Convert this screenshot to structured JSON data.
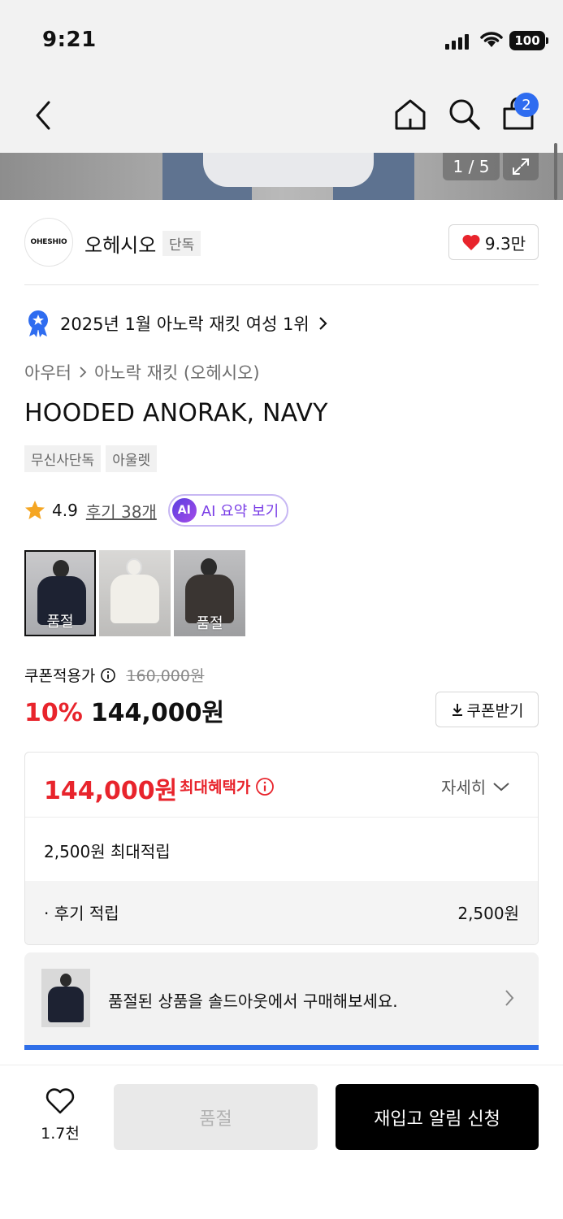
{
  "status_bar": {
    "time": "9:21",
    "battery": "100"
  },
  "nav": {
    "cart_count": "2"
  },
  "gallery": {
    "counter": "1 / 5"
  },
  "brand": {
    "logo_text": "OHESHIO",
    "name": "오헤시오",
    "exclusive_tag": "단독",
    "like_count": "9.3만"
  },
  "ranking": {
    "text": "2025년 1월 아노락 재킷 여성 1위"
  },
  "breadcrumb": {
    "category": "아우터",
    "subcategory": "아노락 재킷 (오헤시오)"
  },
  "product": {
    "title": "HOODED ANORAK, NAVY",
    "tags": [
      "무신사단독",
      "아울렛"
    ],
    "rating": "4.9",
    "reviews": "후기 38개",
    "ai_badge": "AI",
    "ai_summary": "AI 요약 보기"
  },
  "colors": [
    {
      "name": "navy",
      "soldout": "품절"
    },
    {
      "name": "ivory",
      "soldout": ""
    },
    {
      "name": "charcoal",
      "soldout": "품절"
    }
  ],
  "price": {
    "coupon_label": "쿠폰적용가",
    "original": "160,000원",
    "discount": "10%",
    "current": "144,000원",
    "coupon_button": "쿠폰받기"
  },
  "benefit": {
    "max_price": "144,000원",
    "max_label": "최대혜택가",
    "detail": "자세히",
    "points_total": "2,500원 최대적립",
    "review_points_label": "· 후기 적립",
    "review_points_value": "2,500원"
  },
  "soldout_banner": {
    "message": "품절된 상품을 솔드아웃에서 구매해보세요."
  },
  "bottom_bar": {
    "wish_count": "1.7천",
    "soldout_button": "품절",
    "restock_button": "재입고 알림 신청"
  },
  "colors_accent": {
    "red": "#e8242c",
    "blue": "#2e6cf0",
    "purple": "#7a3ee6"
  }
}
